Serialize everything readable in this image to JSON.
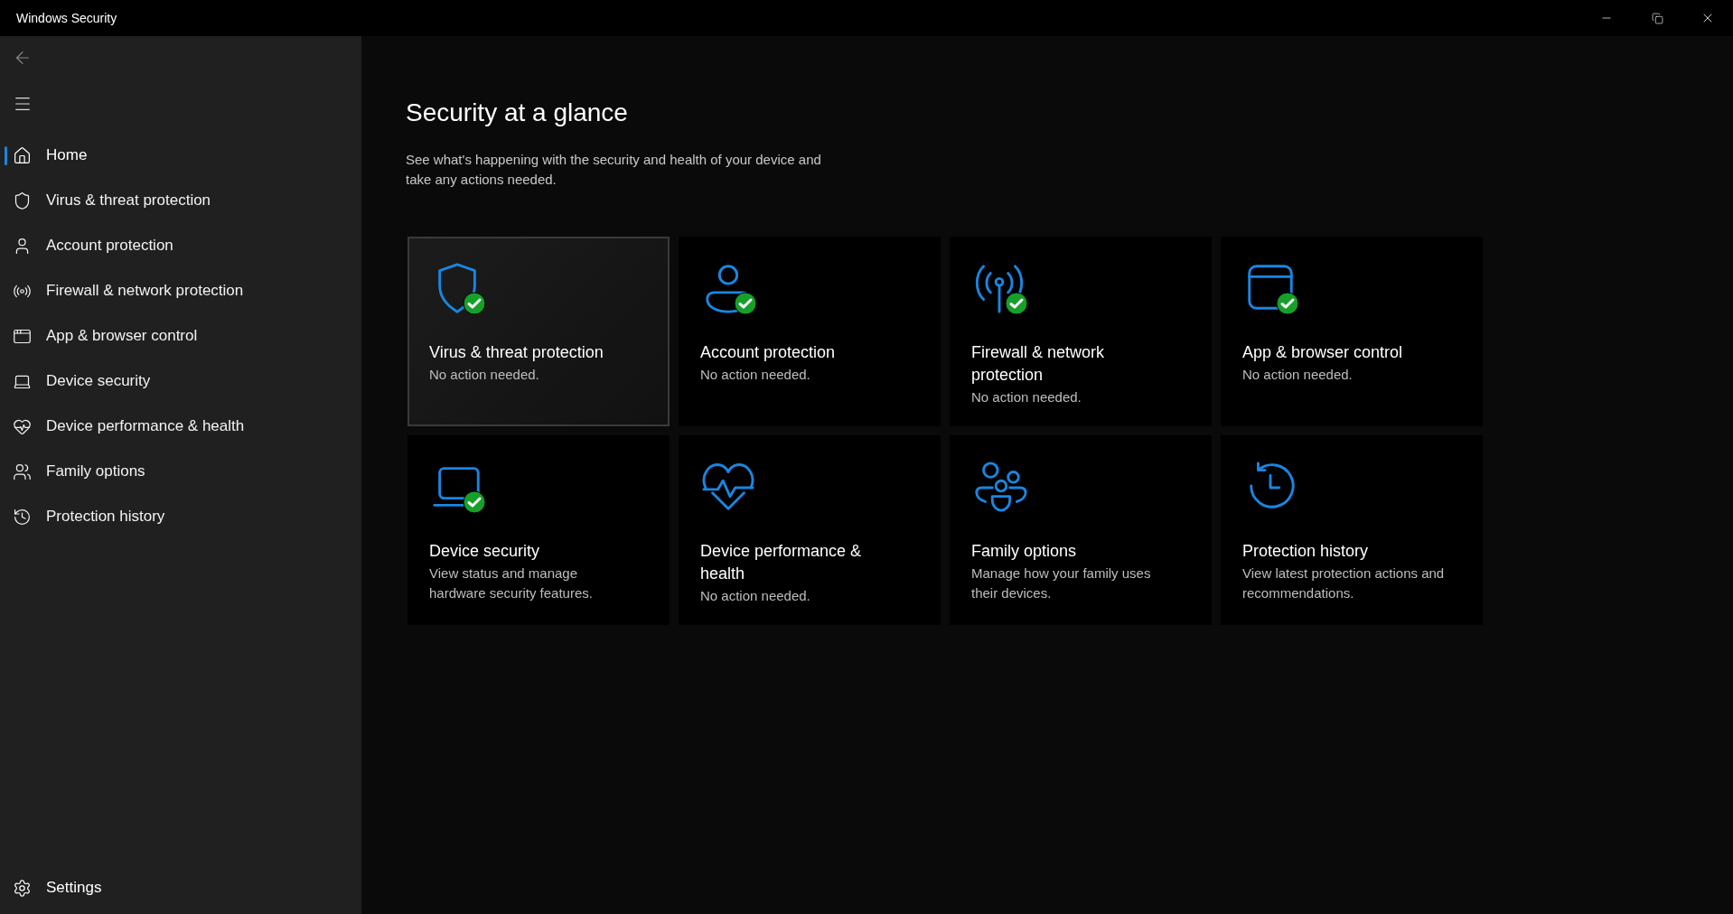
{
  "window": {
    "title": "Windows Security"
  },
  "sidebar": {
    "items": [
      {
        "label": "Home",
        "selected": true
      },
      {
        "label": "Virus & threat protection",
        "selected": false
      },
      {
        "label": "Account protection",
        "selected": false
      },
      {
        "label": "Firewall & network protection",
        "selected": false
      },
      {
        "label": "App & browser control",
        "selected": false
      },
      {
        "label": "Device security",
        "selected": false
      },
      {
        "label": "Device performance & health",
        "selected": false
      },
      {
        "label": "Family options",
        "selected": false
      },
      {
        "label": "Protection history",
        "selected": false
      }
    ],
    "settings": {
      "label": "Settings"
    }
  },
  "page": {
    "title": "Security at a glance",
    "description": "See what's happening with the security and health of your device and take any actions needed."
  },
  "cards": [
    {
      "title": "Virus & threat protection",
      "status": "No action needed.",
      "ok": true,
      "hovered": true
    },
    {
      "title": "Account protection",
      "status": "No action needed.",
      "ok": true,
      "hovered": false
    },
    {
      "title": "Firewall & network protection",
      "status": "No action needed.",
      "ok": true,
      "hovered": false
    },
    {
      "title": "App & browser control",
      "status": "No action needed.",
      "ok": true,
      "hovered": false
    },
    {
      "title": "Device security",
      "status": "View status and manage hardware security features.",
      "ok": true,
      "hovered": false
    },
    {
      "title": "Device performance & health",
      "status": "No action needed.",
      "ok": false,
      "hovered": false
    },
    {
      "title": "Family options",
      "status": "Manage how your family uses their devices.",
      "ok": false,
      "hovered": false
    },
    {
      "title": "Protection history",
      "status": "View latest protection actions and recommendations.",
      "ok": false,
      "hovered": false
    }
  ]
}
